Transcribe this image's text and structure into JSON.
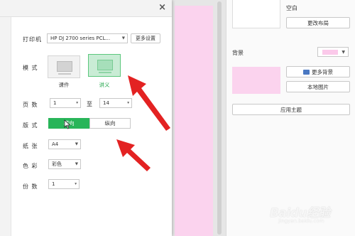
{
  "right_panel": {
    "layout_label": "空白",
    "change_layout_button": "更改布局",
    "background_label": "背景",
    "background_color": "#fbc9ea",
    "more_backgrounds_button": "更多背景",
    "local_image_button": "本地图片",
    "apply_theme_button": "应用主题"
  },
  "dialog": {
    "close_icon": "×",
    "printer_label": "打印机",
    "printer_value": "HP DJ 2700 series PCL...",
    "more_settings_button": "更多设置",
    "mode_label": "模 式",
    "mode_options": [
      "课件",
      "讲义"
    ],
    "mode_selected": "讲义",
    "pages_label": "页 数",
    "page_from": "1",
    "page_to_label": "至",
    "page_to": "14",
    "orientation_label": "版 式",
    "orientation_options": [
      "横向",
      "纵向"
    ],
    "orientation_selected": "横向",
    "paper_label": "纸 张",
    "paper_value": "A4",
    "color_label": "色 彩",
    "color_value": "彩色",
    "copies_label": "份 数",
    "copies_value": "1"
  },
  "watermark": {
    "text": "Baidu经验",
    "sub": "jingyan.baidu.com"
  },
  "colors": {
    "accent_green": "#28b559",
    "annotation_red": "#e32222",
    "slide_pink": "#fbd3ee"
  }
}
